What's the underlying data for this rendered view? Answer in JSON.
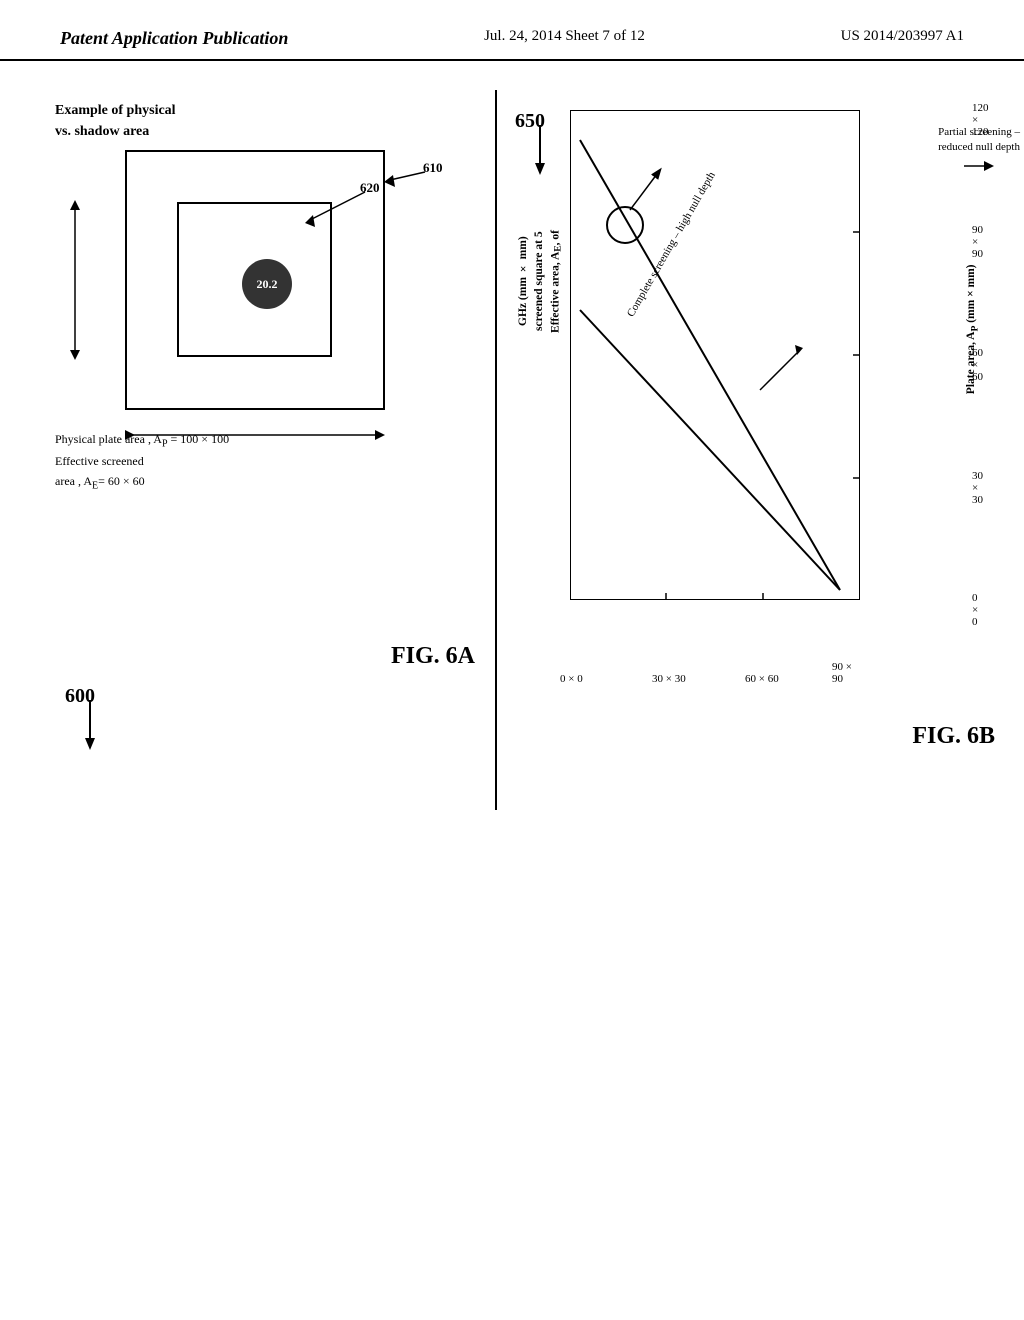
{
  "header": {
    "left": "Patent Application Publication",
    "center": "Jul. 24, 2014   Sheet 7 of 12",
    "right": "US 2014/203997 A1"
  },
  "fig6a": {
    "label": "600",
    "title": "FIG. 6A",
    "description_line1": "Example of physical",
    "description_line2": "vs. shadow area",
    "label_620": "620",
    "label_610": "610",
    "circle_text": "20.2",
    "annotation1": "Physical plate area , A",
    "annotation1_sub": "P",
    "annotation1_val": " = 100 × 100",
    "annotation2": "Effective screened",
    "annotation3": "area , A",
    "annotation3_sub": "E",
    "annotation3_val": "= 60 × 60"
  },
  "fig6b": {
    "label": "650",
    "title": "FIG. 6B",
    "x_axis_line1": "Effective area, A",
    "x_axis_sub": "E",
    "x_axis_line2": ", of",
    "x_axis_line3": "screened square at 5",
    "x_axis_line4": "GHz (mm × mm)",
    "y_axis_line1": "Plate area, A",
    "y_axis_sub": "P",
    "y_axis_line2": " (mm × mm)",
    "x_ticks": [
      "0 × 0",
      "30 × 30",
      "60 × 60",
      "90 × 90"
    ],
    "y_ticks": [
      "0 × 0",
      "30 × 30",
      "60 × 60",
      "90 × 90",
      "120 × 120"
    ],
    "annotation_partial_line1": "Partial screening –",
    "annotation_partial_line2": "reduced null depth",
    "annotation_complete": "Complete screening – high null depth",
    "arrow_label": "→"
  }
}
